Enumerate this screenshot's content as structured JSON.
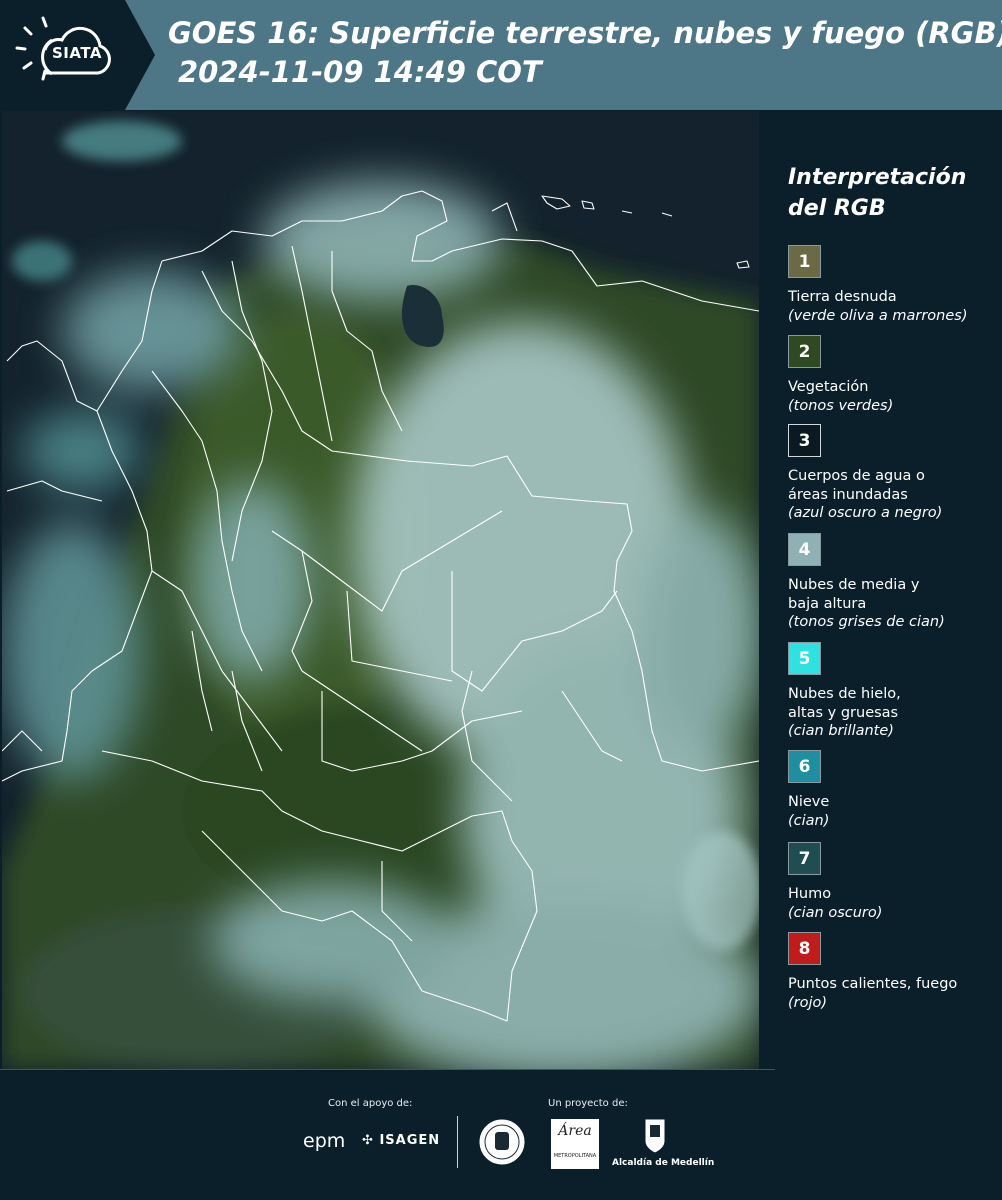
{
  "header": {
    "logo_text": "SIATA",
    "title_line1": "GOES 16: Superficie terrestre, nubes y fuego (RGB)",
    "title_line2": "2024-11-09 14:49 COT"
  },
  "legend": {
    "title_line1": "Interpretación",
    "title_line2": "del RGB",
    "items": [
      {
        "num": "1",
        "label": "Tierra desnuda",
        "sub": "(verde oliva a marrones)",
        "color": "#6b6a45"
      },
      {
        "num": "2",
        "label": "Vegetación",
        "sub": "(tonos verdes)",
        "color": "#2f4a22"
      },
      {
        "num": "3",
        "label": "Cuerpos de agua o",
        "label2": "áreas inundadas",
        "sub": "(azul oscuro a negro)",
        "color": "#0b1a22"
      },
      {
        "num": "4",
        "label": "Nubes de media y",
        "label2": "baja altura",
        "sub": "(tonos grises de cian)",
        "color": "#8fb1b3"
      },
      {
        "num": "5",
        "label": "Nubes de hielo,",
        "label2": "altas y gruesas",
        "sub": "(cian brillante)",
        "color": "#2fe1e1"
      },
      {
        "num": "6",
        "label": "Nieve",
        "sub": "(cian)",
        "color": "#1f8ea0"
      },
      {
        "num": "7",
        "label": "Humo",
        "sub": "(cian oscuro)",
        "color": "#1f4d52"
      },
      {
        "num": "8",
        "label": "Puntos calientes, fuego",
        "sub": "(rojo)",
        "color": "#c11c1c"
      }
    ]
  },
  "footer": {
    "support_label": "Con el apoyo de:",
    "project_label": "Un proyecto de:",
    "epm": "epm",
    "isagen": "ISAGEN",
    "area_name": "Área",
    "area_sub": "METROPOLITANA",
    "alcaldia": "Alcaldía de Medellín"
  },
  "colors": {
    "header_bg": "#4d7687",
    "page_bg": "#0b1f2b",
    "border_line": "#ffffff"
  }
}
